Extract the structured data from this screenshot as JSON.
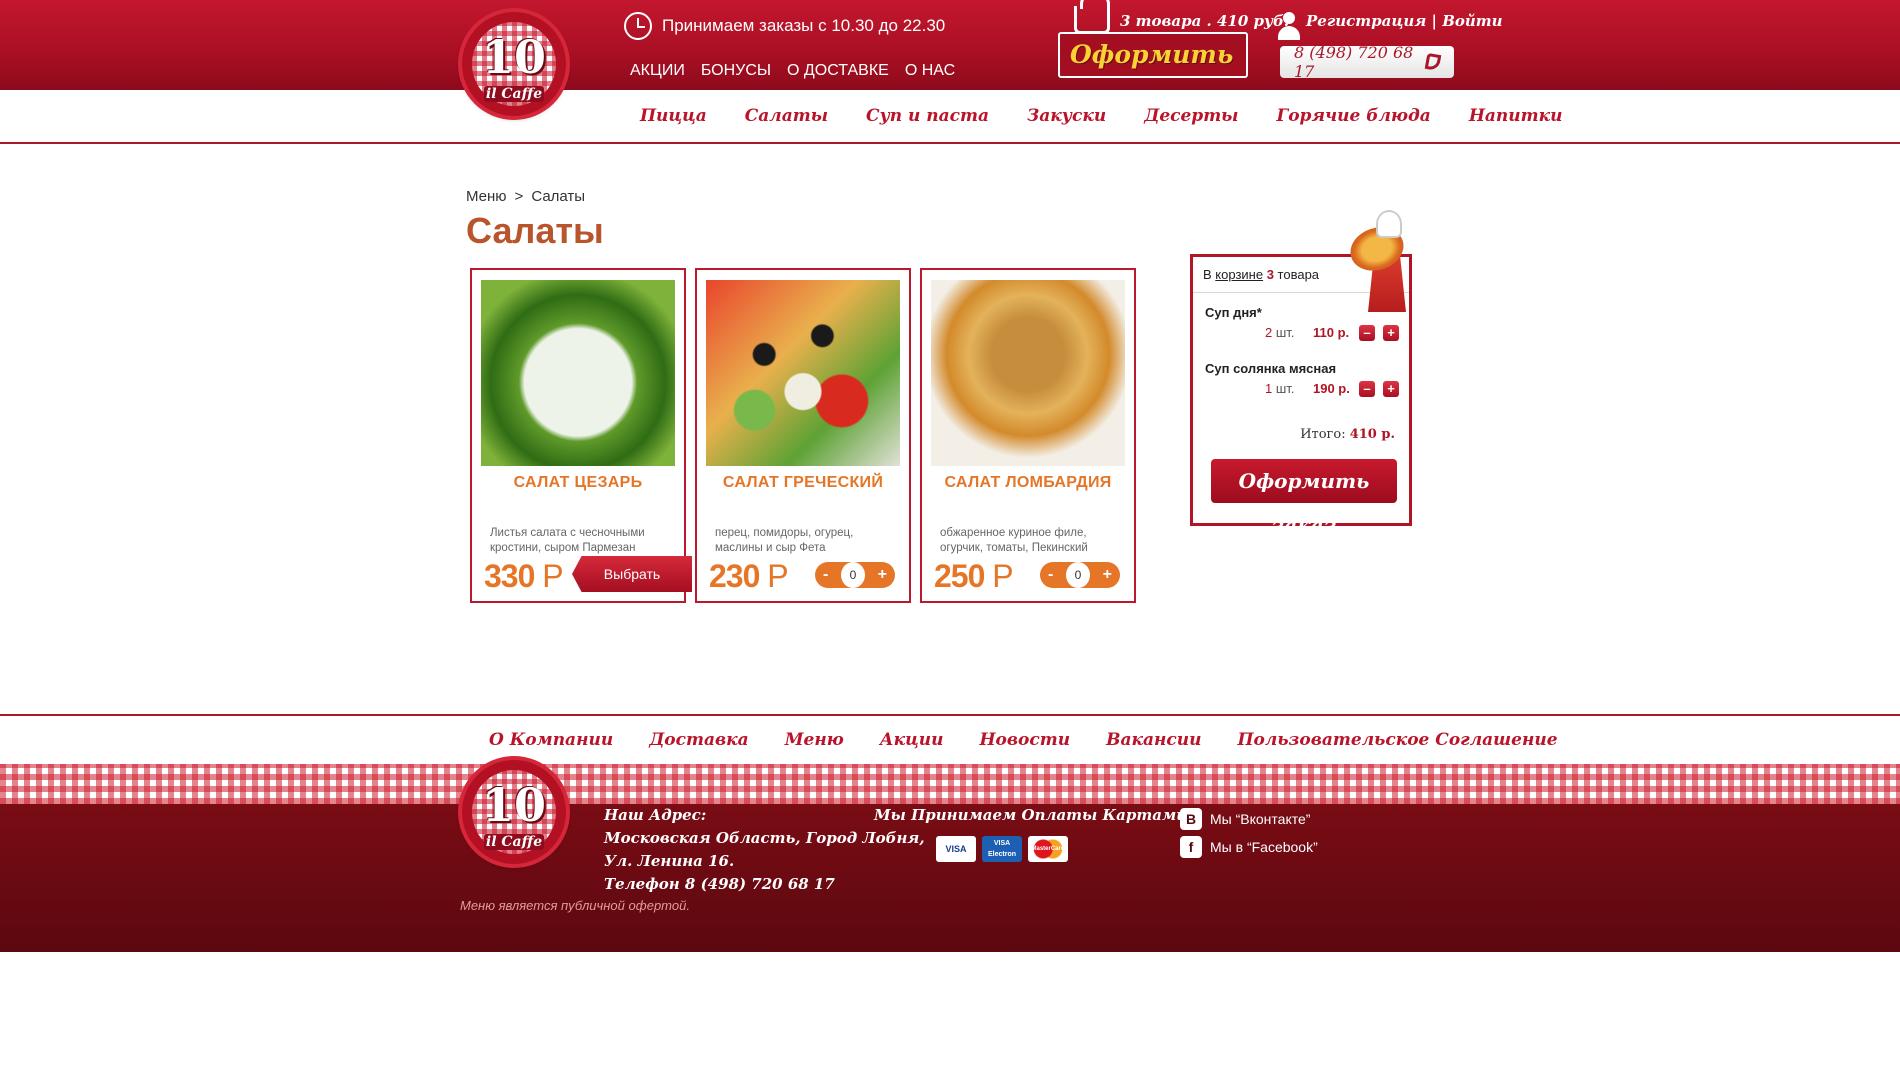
{
  "header": {
    "hours_text": "Принимаем заказы с 10.30 до 22.30",
    "top_links": [
      "АКЦИИ",
      "БОНУСЫ",
      "О ДОСТАВКЕ",
      "О НАС"
    ],
    "cart_summary": "3 товара . 410 руб.",
    "checkout_label": "Оформить",
    "auth": {
      "register": "Регистрация",
      "separator": " | ",
      "login": "Войти"
    },
    "phone": "8 (498) 720 68 17",
    "logo": {
      "number": "10",
      "name": "il Caffe"
    }
  },
  "main_nav": [
    "Пицца",
    "Салаты",
    "Суп и паста",
    "Закуски",
    "Десерты",
    "Горячие блюда",
    "Напитки"
  ],
  "breadcrumb": {
    "root": "Меню",
    "separator": ">",
    "current": "Салаты"
  },
  "page_title": "Салаты",
  "products": [
    {
      "name": "САЛАТ ЦЕЗАРЬ",
      "description": "Листья салата с чесночными кростини, сыром Пармезан",
      "price": "330",
      "currency": "Р",
      "action_label": "Выбрать"
    },
    {
      "name": "САЛАТ ГРЕЧЕСКИЙ",
      "description": "перец, помидоры, огурец, маслины и сыр Фета",
      "price": "230",
      "currency": "Р",
      "qty": "0",
      "minus": "-",
      "plus": "+"
    },
    {
      "name": "САЛАТ ЛОМБАРДИЯ",
      "description": "обжаренное куриное филе, огурчик, томаты, Пекинский",
      "price": "250",
      "currency": "Р",
      "qty": "0",
      "minus": "-",
      "plus": "+"
    }
  ],
  "cart": {
    "prefix": "В ",
    "link": "корзине",
    "count": "3",
    "suffix": " товара",
    "items": [
      {
        "name": "Суп дня*",
        "qty": "2",
        "unit": "шт.",
        "price": "110 р."
      },
      {
        "name": "Суп солянка мясная",
        "qty": "1",
        "unit": "шт.",
        "price": "190 р."
      }
    ],
    "minus": "–",
    "plus": "+",
    "total_label": "Итого:",
    "total_value": "410 р.",
    "order_button": "Оформить заказ"
  },
  "footer": {
    "nav": [
      "О Компании",
      "Доставка",
      "Меню",
      "Акции",
      "Новости",
      "Вакансии",
      "Пользовательское Соглашение"
    ],
    "address": [
      "Наш Адрес:",
      "Московская Область, Город Лобня,",
      "Ул. Ленина 16.",
      "Телефон 8 (498) 720 68 17"
    ],
    "payments_title": "Мы Принимаем Оплаты Картами",
    "cards": [
      "VISA",
      "VISA Electron",
      "MasterCard"
    ],
    "social": [
      {
        "icon": "В",
        "label": "Мы “Вконтакте”"
      },
      {
        "icon": "f",
        "label": "Мы в “Facebook”"
      }
    ],
    "offer": "Меню является публичной офертой."
  },
  "colors": {
    "brand_red": "#b11424",
    "accent_orange": "#e57628",
    "footer_maroon": "#6b0a13"
  }
}
